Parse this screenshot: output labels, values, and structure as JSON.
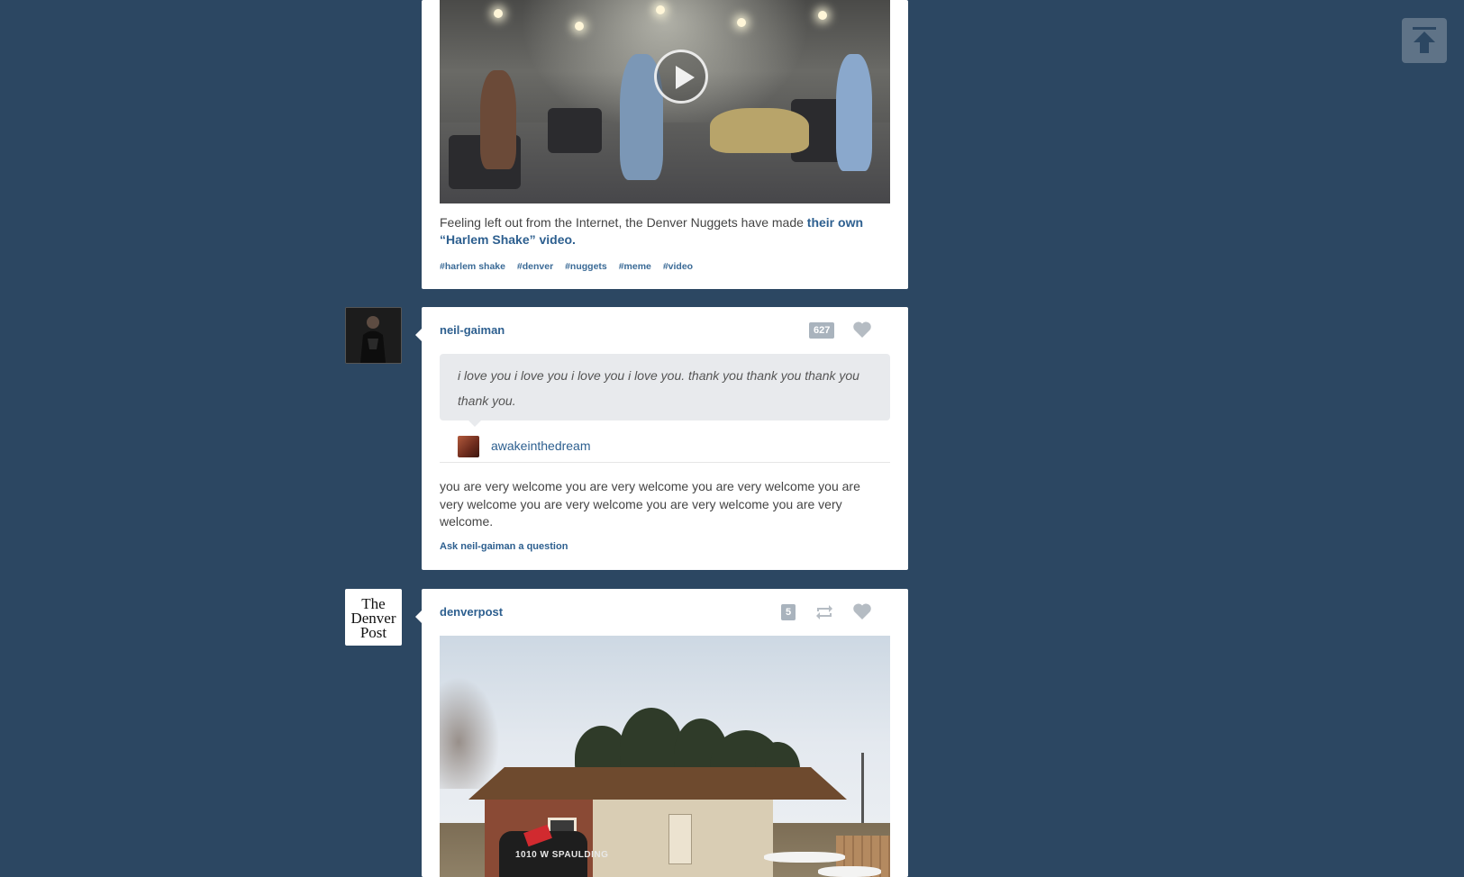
{
  "post_video": {
    "play_icon": "play-icon",
    "caption_text": "Feeling left out from the Internet, the Denver Nuggets have made ",
    "caption_link": "their own “Harlem Shake” video.",
    "tags": [
      "#harlem shake",
      "#denver",
      "#nuggets",
      "#meme",
      "#video"
    ]
  },
  "post_answer": {
    "username": "neil-gaiman",
    "notes_count": "627",
    "question": "i love you i love you i love you i love you. thank you thank you thank you thank you.",
    "asker": "awakeinthedream",
    "answer": "you are very welcome you are very welcome you are very welcome you are very welcome you are very welcome you are very welcome you are very welcome.",
    "ask_link": "Ask neil-gaiman a question"
  },
  "post_photo": {
    "username": "denverpost",
    "notes_count": "5",
    "avatar_logo": [
      "The",
      "Denver",
      "Post"
    ],
    "mailbox_text": "1010 W SPAULDING"
  },
  "icons": {
    "like": "heart-icon",
    "reblog": "reblog-icon",
    "scroll_top": "arrow-up-icon"
  },
  "colors": {
    "background": "#2c4762",
    "link": "#2d5f8f",
    "badge": "#a9b3bd"
  }
}
